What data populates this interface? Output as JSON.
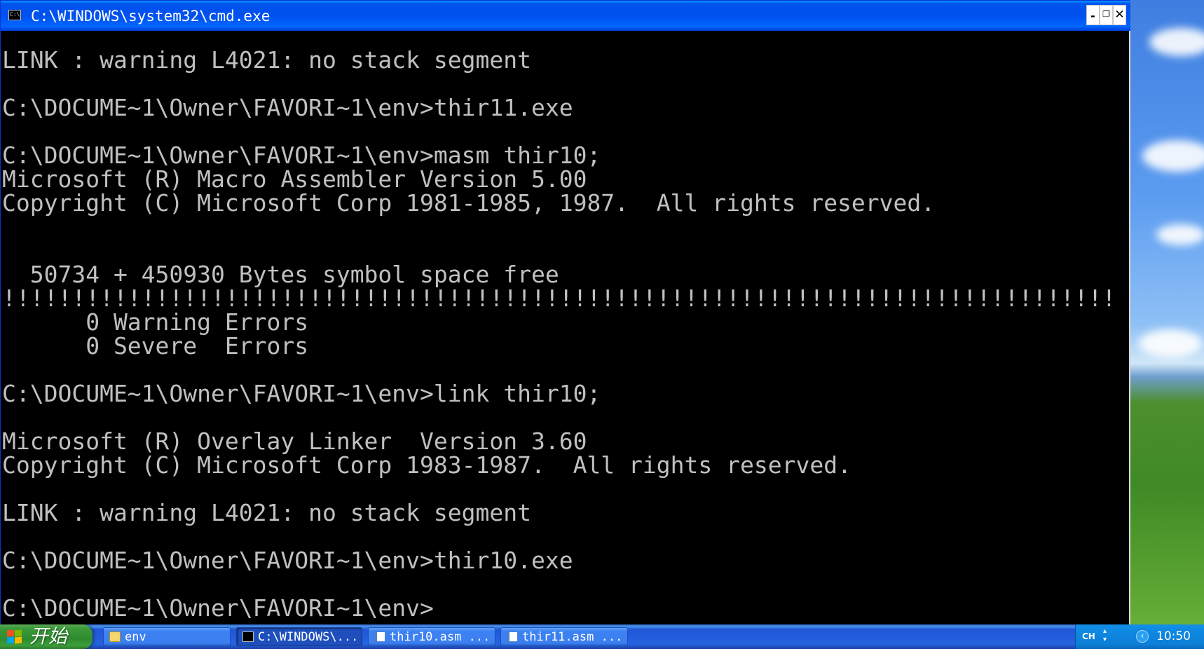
{
  "window": {
    "title": "C:\\WINDOWS\\system32\\cmd.exe",
    "minimize_label": "-",
    "restore_label": "❐",
    "close_label": "✕"
  },
  "console": {
    "lines": [
      "LINK : warning L4021: no stack segment",
      "",
      "C:\\DOCUME~1\\Owner\\FAVORI~1\\env>thir11.exe",
      "",
      "C:\\DOCUME~1\\Owner\\FAVORI~1\\env>masm thir10;",
      "Microsoft (R) Macro Assembler Version 5.00",
      "Copyright (C) Microsoft Corp 1981-1985, 1987.  All rights reserved.",
      "",
      "",
      "  50734 + 450930 Bytes symbol space free",
      "!!!!!!!!!!!!!!!!!!!!!!!!!!!!!!!!!!!!!!!!!!!!!!!!!!!!!!!!!!!!!!!!!!!!!!!!!!!!!!!!",
      "      0 Warning Errors",
      "      0 Severe  Errors",
      "",
      "C:\\DOCUME~1\\Owner\\FAVORI~1\\env>link thir10;",
      "",
      "Microsoft (R) Overlay Linker  Version 3.60",
      "Copyright (C) Microsoft Corp 1983-1987.  All rights reserved.",
      "",
      "LINK : warning L4021: no stack segment",
      "",
      "C:\\DOCUME~1\\Owner\\FAVORI~1\\env>thir10.exe",
      "",
      "C:\\DOCUME~1\\Owner\\FAVORI~1\\env>"
    ]
  },
  "taskbar": {
    "start_label": "开始",
    "tasks": [
      {
        "label": "env",
        "icon": "folder-icon",
        "active": false
      },
      {
        "label": "C:\\WINDOWS\\...",
        "icon": "cmd-icon",
        "active": true
      },
      {
        "label": "thir10.asm ...",
        "icon": "document-icon",
        "active": false
      },
      {
        "label": "thir11.asm ...",
        "icon": "document-icon",
        "active": false
      }
    ],
    "tray": {
      "language": "CH",
      "clock": "10:50"
    }
  },
  "colors": {
    "console_text": "#c0c0c0",
    "console_background": "#000000",
    "titlebar_blue": "#0053ee",
    "start_green": "#3c9a3a",
    "taskbar_blue": "#2663e0"
  }
}
